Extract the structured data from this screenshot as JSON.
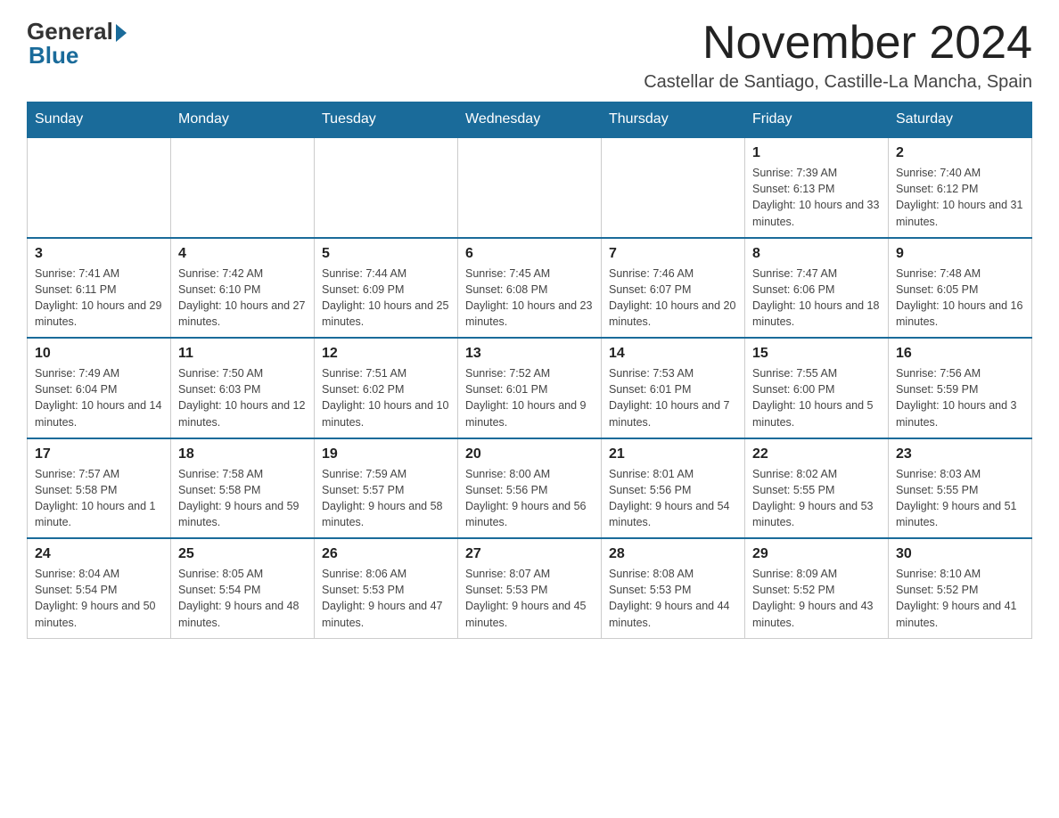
{
  "logo": {
    "general": "General",
    "blue": "Blue"
  },
  "title": "November 2024",
  "subtitle": "Castellar de Santiago, Castille-La Mancha, Spain",
  "days_of_week": [
    "Sunday",
    "Monday",
    "Tuesday",
    "Wednesday",
    "Thursday",
    "Friday",
    "Saturday"
  ],
  "weeks": [
    [
      {
        "day": "",
        "info": ""
      },
      {
        "day": "",
        "info": ""
      },
      {
        "day": "",
        "info": ""
      },
      {
        "day": "",
        "info": ""
      },
      {
        "day": "",
        "info": ""
      },
      {
        "day": "1",
        "info": "Sunrise: 7:39 AM\nSunset: 6:13 PM\nDaylight: 10 hours and 33 minutes."
      },
      {
        "day": "2",
        "info": "Sunrise: 7:40 AM\nSunset: 6:12 PM\nDaylight: 10 hours and 31 minutes."
      }
    ],
    [
      {
        "day": "3",
        "info": "Sunrise: 7:41 AM\nSunset: 6:11 PM\nDaylight: 10 hours and 29 minutes."
      },
      {
        "day": "4",
        "info": "Sunrise: 7:42 AM\nSunset: 6:10 PM\nDaylight: 10 hours and 27 minutes."
      },
      {
        "day": "5",
        "info": "Sunrise: 7:44 AM\nSunset: 6:09 PM\nDaylight: 10 hours and 25 minutes."
      },
      {
        "day": "6",
        "info": "Sunrise: 7:45 AM\nSunset: 6:08 PM\nDaylight: 10 hours and 23 minutes."
      },
      {
        "day": "7",
        "info": "Sunrise: 7:46 AM\nSunset: 6:07 PM\nDaylight: 10 hours and 20 minutes."
      },
      {
        "day": "8",
        "info": "Sunrise: 7:47 AM\nSunset: 6:06 PM\nDaylight: 10 hours and 18 minutes."
      },
      {
        "day": "9",
        "info": "Sunrise: 7:48 AM\nSunset: 6:05 PM\nDaylight: 10 hours and 16 minutes."
      }
    ],
    [
      {
        "day": "10",
        "info": "Sunrise: 7:49 AM\nSunset: 6:04 PM\nDaylight: 10 hours and 14 minutes."
      },
      {
        "day": "11",
        "info": "Sunrise: 7:50 AM\nSunset: 6:03 PM\nDaylight: 10 hours and 12 minutes."
      },
      {
        "day": "12",
        "info": "Sunrise: 7:51 AM\nSunset: 6:02 PM\nDaylight: 10 hours and 10 minutes."
      },
      {
        "day": "13",
        "info": "Sunrise: 7:52 AM\nSunset: 6:01 PM\nDaylight: 10 hours and 9 minutes."
      },
      {
        "day": "14",
        "info": "Sunrise: 7:53 AM\nSunset: 6:01 PM\nDaylight: 10 hours and 7 minutes."
      },
      {
        "day": "15",
        "info": "Sunrise: 7:55 AM\nSunset: 6:00 PM\nDaylight: 10 hours and 5 minutes."
      },
      {
        "day": "16",
        "info": "Sunrise: 7:56 AM\nSunset: 5:59 PM\nDaylight: 10 hours and 3 minutes."
      }
    ],
    [
      {
        "day": "17",
        "info": "Sunrise: 7:57 AM\nSunset: 5:58 PM\nDaylight: 10 hours and 1 minute."
      },
      {
        "day": "18",
        "info": "Sunrise: 7:58 AM\nSunset: 5:58 PM\nDaylight: 9 hours and 59 minutes."
      },
      {
        "day": "19",
        "info": "Sunrise: 7:59 AM\nSunset: 5:57 PM\nDaylight: 9 hours and 58 minutes."
      },
      {
        "day": "20",
        "info": "Sunrise: 8:00 AM\nSunset: 5:56 PM\nDaylight: 9 hours and 56 minutes."
      },
      {
        "day": "21",
        "info": "Sunrise: 8:01 AM\nSunset: 5:56 PM\nDaylight: 9 hours and 54 minutes."
      },
      {
        "day": "22",
        "info": "Sunrise: 8:02 AM\nSunset: 5:55 PM\nDaylight: 9 hours and 53 minutes."
      },
      {
        "day": "23",
        "info": "Sunrise: 8:03 AM\nSunset: 5:55 PM\nDaylight: 9 hours and 51 minutes."
      }
    ],
    [
      {
        "day": "24",
        "info": "Sunrise: 8:04 AM\nSunset: 5:54 PM\nDaylight: 9 hours and 50 minutes."
      },
      {
        "day": "25",
        "info": "Sunrise: 8:05 AM\nSunset: 5:54 PM\nDaylight: 9 hours and 48 minutes."
      },
      {
        "day": "26",
        "info": "Sunrise: 8:06 AM\nSunset: 5:53 PM\nDaylight: 9 hours and 47 minutes."
      },
      {
        "day": "27",
        "info": "Sunrise: 8:07 AM\nSunset: 5:53 PM\nDaylight: 9 hours and 45 minutes."
      },
      {
        "day": "28",
        "info": "Sunrise: 8:08 AM\nSunset: 5:53 PM\nDaylight: 9 hours and 44 minutes."
      },
      {
        "day": "29",
        "info": "Sunrise: 8:09 AM\nSunset: 5:52 PM\nDaylight: 9 hours and 43 minutes."
      },
      {
        "day": "30",
        "info": "Sunrise: 8:10 AM\nSunset: 5:52 PM\nDaylight: 9 hours and 41 minutes."
      }
    ]
  ]
}
